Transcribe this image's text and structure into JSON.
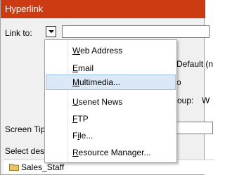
{
  "window": {
    "title": "Hyperlink"
  },
  "link_to": {
    "label": "Link to:",
    "value": ""
  },
  "background": {
    "default_text": "Default (n",
    "o_text": "o",
    "oup_text": "oup:",
    "w_text": "W"
  },
  "screen_tip": {
    "label": "Screen Tip",
    "value": ""
  },
  "select_destination": {
    "label": "Select desti"
  },
  "tree": {
    "item": "Sales_Staff"
  },
  "menu": {
    "items": [
      {
        "pre": "",
        "key": "W",
        "post": "eb Address",
        "highlighted": false
      },
      {
        "pre": "",
        "key": "E",
        "post": "mail",
        "highlighted": false
      },
      {
        "pre": "",
        "key": "M",
        "post": "ultimedia...",
        "highlighted": true
      },
      {
        "pre": "",
        "key": "U",
        "post": "senet News",
        "highlighted": false
      },
      {
        "pre": "",
        "key": "F",
        "post": "TP",
        "highlighted": false
      },
      {
        "pre": "F",
        "key": "i",
        "post": "le...",
        "highlighted": false
      },
      {
        "pre": "",
        "key": "R",
        "post": "esource Manager...",
        "highlighted": false
      }
    ]
  },
  "colors": {
    "titlebar": "#cc3b12",
    "highlight": "#dbe8f7",
    "highlight_border": "#9cc0ea",
    "folder": "#e8c46a"
  }
}
